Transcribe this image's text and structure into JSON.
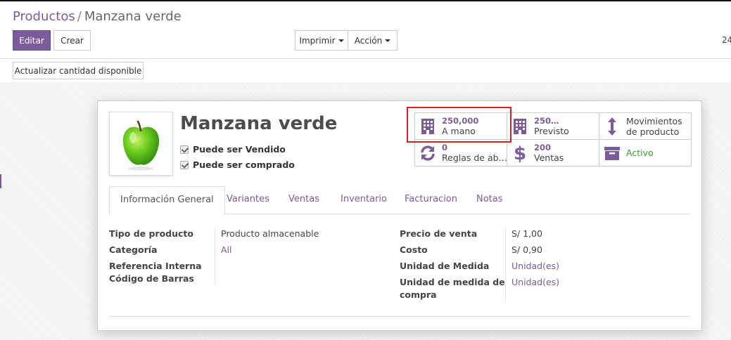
{
  "breadcrumb": {
    "parent": "Productos",
    "separator": "/",
    "current": "Manzana verde"
  },
  "toolbar": {
    "edit_label": "Editar",
    "create_label": "Crear",
    "print_label": "Imprimir",
    "action_label": "Acción",
    "pager_text": "24"
  },
  "statusbar": {
    "update_qty_label": "Actualizar cantidad disponible"
  },
  "product": {
    "name": "Manzana verde",
    "image_icon": "green-apple",
    "can_be_sold_label": "Puede ser Vendido",
    "can_be_purchased_label": "Puede ser comprado",
    "can_be_sold": true,
    "can_be_purchased": true
  },
  "stats": {
    "on_hand": {
      "value": "250,000",
      "label": "A mano",
      "icon": "building-icon"
    },
    "forecast": {
      "value": "250…",
      "label": "Previsto",
      "icon": "building-icon"
    },
    "moves": {
      "label_line1": "Movimientos",
      "label_line2": "de producto",
      "icon": "updown-arrow-icon"
    },
    "reorder": {
      "value": "0",
      "label": "Reglas de ab…",
      "icon": "refresh-icon"
    },
    "sales": {
      "value": "200",
      "label": "Ventas",
      "icon": "dollar-icon"
    },
    "active": {
      "label": "Activo",
      "icon": "archive-icon"
    }
  },
  "tabs": [
    "Información General",
    "Variantes",
    "Ventas",
    "Inventario",
    "Facturacion",
    "Notas"
  ],
  "general": {
    "left": [
      {
        "label": "Tipo de producto",
        "value": "Producto almacenable",
        "link": false
      },
      {
        "label": "Categoría",
        "value": "All",
        "link": true
      },
      {
        "label": "Referencia Interna",
        "value": "",
        "link": false
      },
      {
        "label": "Código de Barras",
        "value": "",
        "link": false
      }
    ],
    "right": [
      {
        "label": "Precio de venta",
        "value": "S/ 1,00",
        "link": false
      },
      {
        "label": "Costo",
        "value": "S/ 0,90",
        "link": false
      },
      {
        "label": "Unidad de Medida",
        "value": "Unidad(es)",
        "link": true
      },
      {
        "label_line1": "Unidad de medida de",
        "label_line2": "compra",
        "value": "Unidad(es)",
        "link": true
      }
    ]
  },
  "colors": {
    "brand": "#7c5b9c",
    "active_green": "#3a9a3a",
    "highlight_red": "#e02020"
  }
}
